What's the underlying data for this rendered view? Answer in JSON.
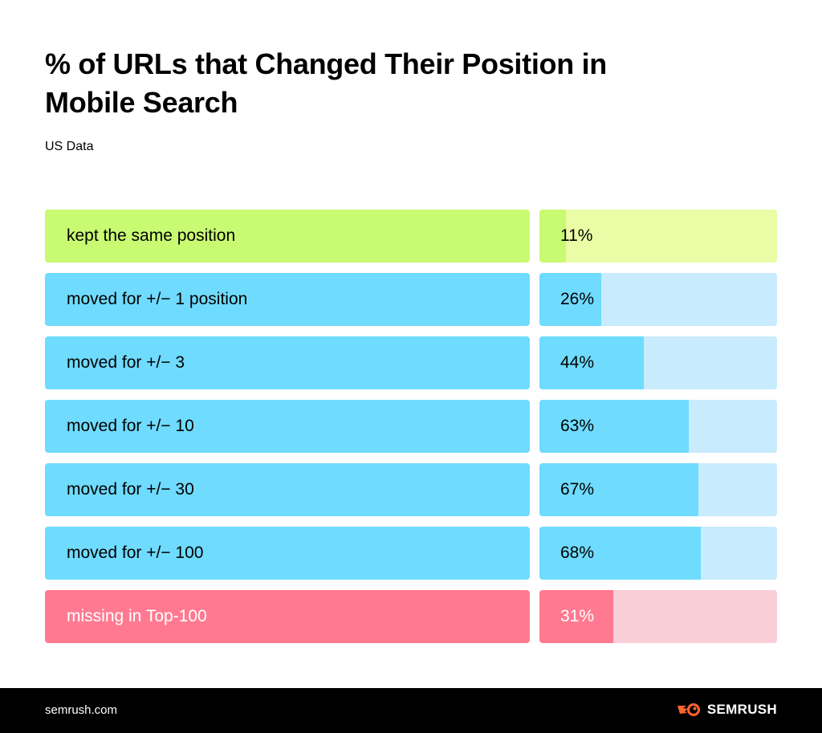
{
  "chart_data": {
    "type": "bar",
    "orientation": "horizontal",
    "title": "% of URLs that Changed Their Position in Mobile Search",
    "subtitle": "US Data",
    "xlabel": "",
    "ylabel": "",
    "xlim": [
      0,
      100
    ],
    "unit": "%",
    "grid": false,
    "legend": "none",
    "categories": [
      "kept the same position",
      "moved for +/− 1 position",
      "moved for +/− 3",
      "moved for +/− 10",
      "moved for +/− 30",
      "moved for +/− 100",
      "missing in Top-100"
    ],
    "values": [
      11,
      26,
      44,
      63,
      67,
      68,
      31
    ],
    "value_labels": [
      "11%",
      "26%",
      "44%",
      "63%",
      "67%",
      "68%",
      "31%"
    ],
    "colors": [
      {
        "label_bg": "#c8fa72",
        "fill": "#c8fa72",
        "track": "#eafda6",
        "text": "#000000"
      },
      {
        "label_bg": "#6fdbff",
        "fill": "#6fdbff",
        "track": "#c8ebfd",
        "text": "#000000"
      },
      {
        "label_bg": "#6fdbff",
        "fill": "#6fdbff",
        "track": "#c8ebfd",
        "text": "#000000"
      },
      {
        "label_bg": "#6fdbff",
        "fill": "#6fdbff",
        "track": "#c8ebfd",
        "text": "#000000"
      },
      {
        "label_bg": "#6fdbff",
        "fill": "#6fdbff",
        "track": "#c8ebfd",
        "text": "#000000"
      },
      {
        "label_bg": "#6fdbff",
        "fill": "#6fdbff",
        "track": "#c8ebfd",
        "text": "#000000"
      },
      {
        "label_bg": "#ff7a91",
        "fill": "#ff7a91",
        "track": "#f9ced6",
        "text": "#ffffff"
      }
    ]
  },
  "footer": {
    "url": "semrush.com",
    "brand": "SEMRUSH",
    "brand_icon": "semrush-fireball-icon",
    "brand_color": "#ff642d"
  }
}
